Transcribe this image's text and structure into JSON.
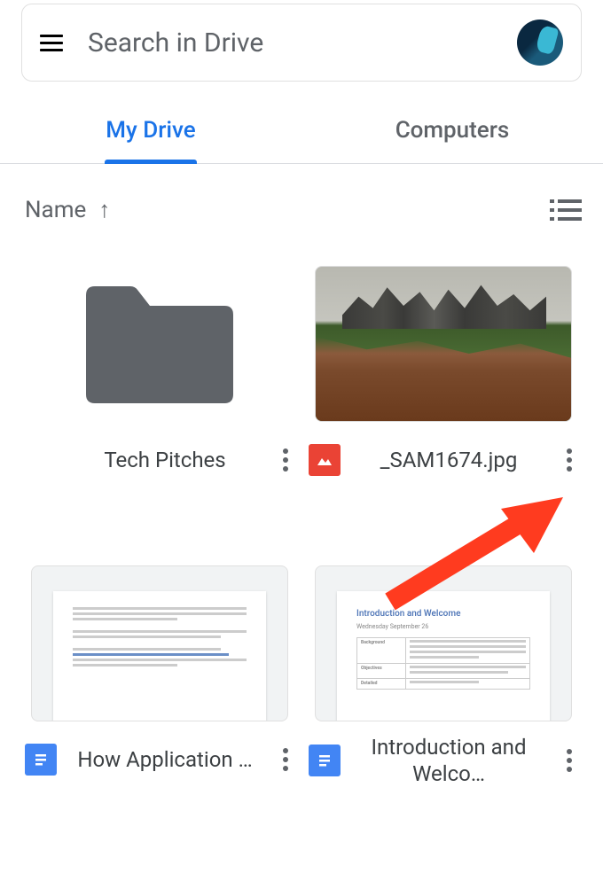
{
  "search": {
    "placeholder": "Search in Drive"
  },
  "tabs": {
    "active": "My Drive",
    "inactive": "Computers"
  },
  "sort": {
    "label": "Name",
    "direction": "asc"
  },
  "items": [
    {
      "type": "folder",
      "name": "Tech Pitches"
    },
    {
      "type": "image",
      "name": "_SAM1674.jpg"
    },
    {
      "type": "gdoc",
      "name": "How Application …"
    },
    {
      "type": "gdoc",
      "name": "Introduction and Welco…"
    }
  ],
  "doc_preview": {
    "title": "Introduction and Welcome",
    "subtitle": "Wednesday September 26"
  }
}
